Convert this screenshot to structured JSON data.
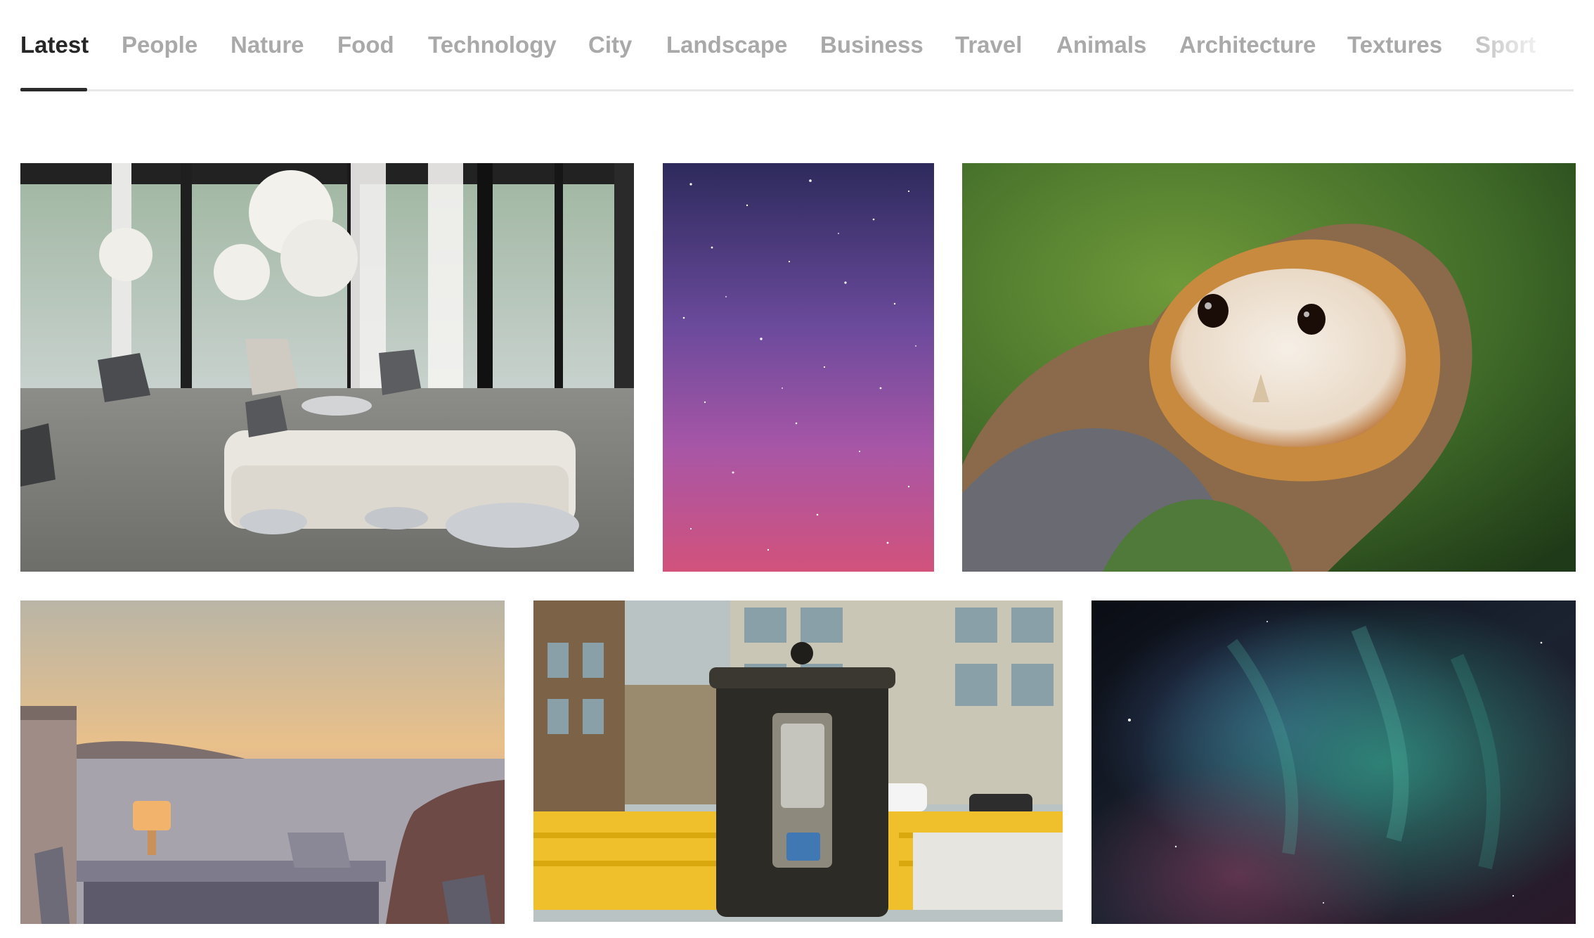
{
  "tabs": [
    {
      "label": "Latest",
      "active": true
    },
    {
      "label": "People"
    },
    {
      "label": "Nature"
    },
    {
      "label": "Food"
    },
    {
      "label": "Technology"
    },
    {
      "label": "City"
    },
    {
      "label": "Landscape"
    },
    {
      "label": "Business"
    },
    {
      "label": "Travel"
    },
    {
      "label": "Animals"
    },
    {
      "label": "Architecture"
    },
    {
      "label": "Textures"
    },
    {
      "label": "Sport"
    }
  ],
  "photos": [
    {
      "subject": "interior-lounge"
    },
    {
      "subject": "starry-sky"
    },
    {
      "subject": "barn-owl"
    },
    {
      "subject": "seaside-terrace"
    },
    {
      "subject": "payphone-street"
    },
    {
      "subject": "aurora"
    }
  ],
  "colors": {
    "active_tab": "#262626",
    "inactive_tab": "#a9a9a9",
    "tab_rule": "#e7e7e7"
  }
}
